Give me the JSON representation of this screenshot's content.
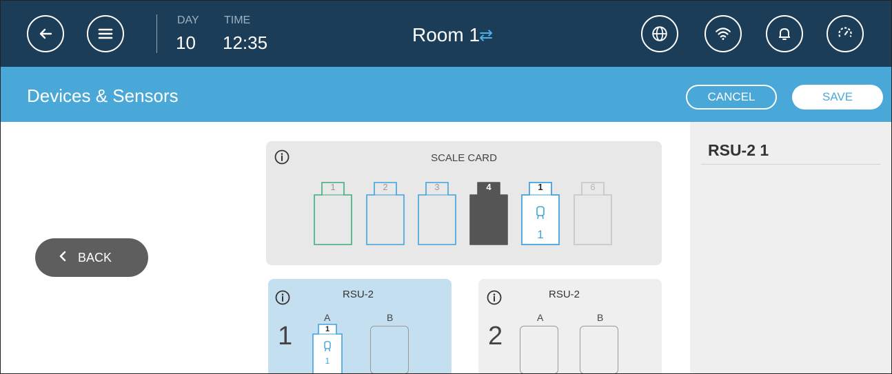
{
  "header": {
    "day_label": "DAY",
    "day_value": "10",
    "time_label": "TIME",
    "time_value": "12:35",
    "room": "Room 1",
    "room_switch_icon": "swap-arrows-icon",
    "left_icons": [
      "back-arrow-icon",
      "menu-icon"
    ],
    "right_icons": [
      "globe-icon",
      "wifi-icon",
      "bell-icon",
      "gauge-icon"
    ]
  },
  "titlebar": {
    "title": "Devices & Sensors",
    "cancel_label": "CANCEL",
    "save_label": "SAVE"
  },
  "back_button": {
    "label": "BACK"
  },
  "right_panel": {
    "title": "RSU-2  1"
  },
  "scale_card": {
    "title": "SCALE CARD",
    "slots": [
      {
        "label": "1",
        "state": "empty",
        "color": "#3cae7a"
      },
      {
        "label": "2",
        "state": "empty",
        "color": "#3fa3dc"
      },
      {
        "label": "3",
        "state": "empty",
        "color": "#3fa3dc"
      },
      {
        "label": "4",
        "state": "filled",
        "color": "#555555"
      },
      {
        "label": "1",
        "state": "selected",
        "color": "#3fa3dc",
        "sub_label": "1"
      },
      {
        "label": "6",
        "state": "disabled",
        "color": "#bdbdbd"
      }
    ]
  },
  "rsu_cards": [
    {
      "name": "RSU-2",
      "number": "1",
      "slot_a_label": "A",
      "slot_b_label": "B",
      "slot_a_top": "1",
      "slot_a_bottom": "1",
      "selected": true
    },
    {
      "name": "RSU-2",
      "number": "2",
      "slot_a_label": "A",
      "slot_b_label": "B",
      "selected": false
    }
  ],
  "colors": {
    "topbar": "#1c3d57",
    "titlebar": "#4aa8d8",
    "selected_card": "#c4dff0",
    "card": "#e8e8e8"
  }
}
